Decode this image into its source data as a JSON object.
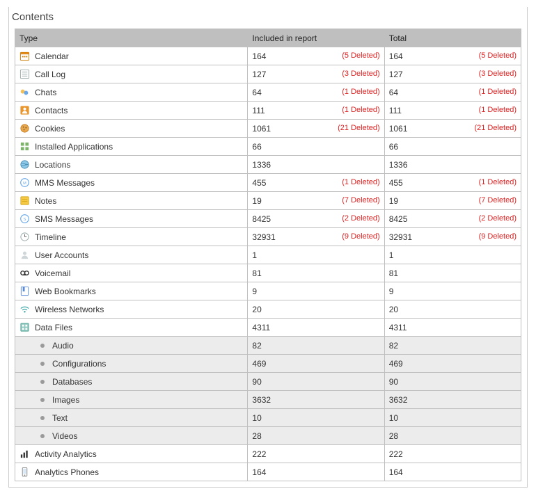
{
  "title": "Contents",
  "columns": {
    "type": "Type",
    "included": "Included in report",
    "total": "Total"
  },
  "rows": [
    {
      "icon": "calendar",
      "label": "Calendar",
      "included": 164,
      "included_deleted": 5,
      "total": 164,
      "total_deleted": 5
    },
    {
      "icon": "calllog",
      "label": "Call Log",
      "included": 127,
      "included_deleted": 3,
      "total": 127,
      "total_deleted": 3
    },
    {
      "icon": "chats",
      "label": "Chats",
      "included": 64,
      "included_deleted": 1,
      "total": 64,
      "total_deleted": 1
    },
    {
      "icon": "contacts",
      "label": "Contacts",
      "included": 111,
      "included_deleted": 1,
      "total": 111,
      "total_deleted": 1
    },
    {
      "icon": "cookies",
      "label": "Cookies",
      "included": 1061,
      "included_deleted": 21,
      "total": 1061,
      "total_deleted": 21
    },
    {
      "icon": "apps",
      "label": "Installed Applications",
      "included": 66,
      "total": 66
    },
    {
      "icon": "locations",
      "label": "Locations",
      "included": 1336,
      "total": 1336
    },
    {
      "icon": "mms",
      "label": "MMS Messages",
      "included": 455,
      "included_deleted": 1,
      "total": 455,
      "total_deleted": 1
    },
    {
      "icon": "notes",
      "label": "Notes",
      "included": 19,
      "included_deleted": 7,
      "total": 19,
      "total_deleted": 7
    },
    {
      "icon": "sms",
      "label": "SMS Messages",
      "included": 8425,
      "included_deleted": 2,
      "total": 8425,
      "total_deleted": 2
    },
    {
      "icon": "timeline",
      "label": "Timeline",
      "included": 32931,
      "included_deleted": 9,
      "total": 32931,
      "total_deleted": 9
    },
    {
      "icon": "user",
      "label": "User Accounts",
      "included": 1,
      "total": 1
    },
    {
      "icon": "voicemail",
      "label": "Voicemail",
      "included": 81,
      "total": 81
    },
    {
      "icon": "bookmarks",
      "label": "Web Bookmarks",
      "included": 9,
      "total": 9
    },
    {
      "icon": "wireless",
      "label": "Wireless Networks",
      "included": 20,
      "total": 20
    },
    {
      "icon": "datafiles",
      "label": "Data Files",
      "included": 4311,
      "total": 4311
    },
    {
      "icon": "bullet",
      "label": "Audio",
      "sub": true,
      "included": 82,
      "total": 82
    },
    {
      "icon": "bullet",
      "label": "Configurations",
      "sub": true,
      "included": 469,
      "total": 469
    },
    {
      "icon": "bullet",
      "label": "Databases",
      "sub": true,
      "included": 90,
      "total": 90
    },
    {
      "icon": "bullet",
      "label": "Images",
      "sub": true,
      "included": 3632,
      "total": 3632
    },
    {
      "icon": "bullet",
      "label": "Text",
      "sub": true,
      "included": 10,
      "total": 10
    },
    {
      "icon": "bullet",
      "label": "Videos",
      "sub": true,
      "included": 28,
      "total": 28
    },
    {
      "icon": "analytics",
      "label": "Activity Analytics",
      "included": 222,
      "total": 222
    },
    {
      "icon": "phones",
      "label": "Analytics Phones",
      "included": 164,
      "total": 164
    }
  ],
  "deleted_format": {
    "prefix": "(",
    "suffix": " Deleted)"
  }
}
